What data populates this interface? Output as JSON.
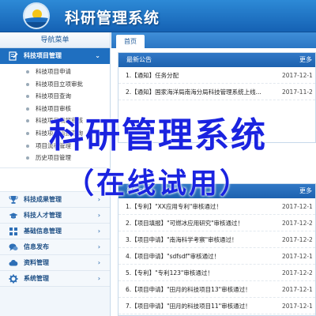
{
  "header": {
    "app_title": "科研管理系统"
  },
  "sidebar": {
    "nav_title": "导航菜单",
    "active_group": {
      "label": "科技项目管理",
      "icon": "edit-icon"
    },
    "sub_items": [
      "科技项目申请",
      "科技项目立项审批",
      "科技项目查询",
      "科技项目审核",
      "科技项目填报审核",
      "科技项目填报查询",
      "项目流程管理",
      "历史项目管理"
    ],
    "groups": [
      {
        "label": "科技成果管理",
        "icon": "trophy-icon"
      },
      {
        "label": "科技人才管理",
        "icon": "graduation-cap-icon"
      },
      {
        "label": "基础信息管理",
        "icon": "grid-icon"
      },
      {
        "label": "信息发布",
        "icon": "chat-bubble-icon"
      },
      {
        "label": "资料管理",
        "icon": "cloud-icon"
      },
      {
        "label": "系统管理",
        "icon": "gear-icon"
      }
    ]
  },
  "main": {
    "tab_label": "首页",
    "announcements": {
      "title": "最新公告",
      "more_label": "更多",
      "rows": [
        {
          "text": "1.【通知】任务分配",
          "date": "2017-12-1"
        },
        {
          "text": "2.【通知】国家海洋局南海分局科技管理系统上线...",
          "date": "2017-11-2"
        }
      ]
    },
    "audits": {
      "title": "最新动态",
      "more_label": "更多",
      "rows": [
        {
          "text": "1.【专利】\"XX应用专利\"审核通过！",
          "date": "2017-12-1"
        },
        {
          "text": "2.【项目填报】\"可燃冰应用研究\"审核通过！",
          "date": "2017-12-2"
        },
        {
          "text": "3.【项目申请】\"南海科学考察\"审核通过！",
          "date": "2017-12-2"
        },
        {
          "text": "4.【项目申请】\"sdfsdf\"审核通过！",
          "date": "2017-12-1"
        },
        {
          "text": "5.【专利】\"专利123\"审核通过！",
          "date": "2017-12-2"
        },
        {
          "text": "6.【项目申请】\"田月的科技项目13\"审核通过！",
          "date": "2017-12-1"
        },
        {
          "text": "7.【项目申请】\"田月的科技项目11\"审核通过！",
          "date": "2017-12-1"
        }
      ]
    }
  },
  "overlay": {
    "title": "科研管理系统",
    "subtitle": "（在线试用）"
  },
  "colors": {
    "header_blue": "#1f6fc0",
    "watermark_blue": "#1a23e0"
  }
}
